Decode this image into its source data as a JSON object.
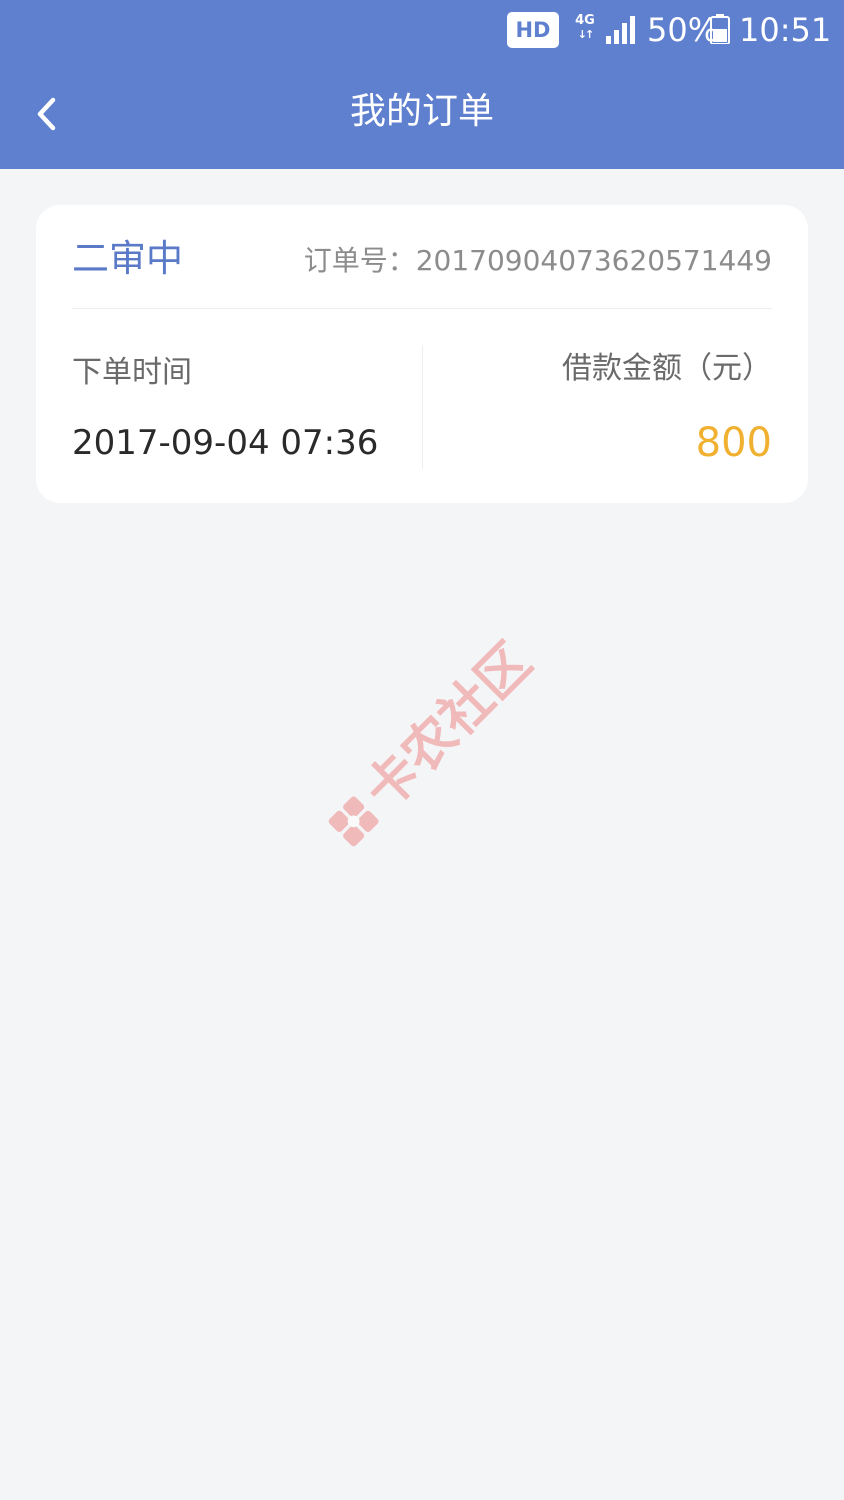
{
  "status_bar": {
    "hd_badge": "HD",
    "network": "4G",
    "battery_percent": "50%",
    "time": "10:51"
  },
  "header": {
    "title": "我的订单",
    "background_color": "#5f7fcf"
  },
  "order": {
    "status": "二审中",
    "order_number_label": "订单号：",
    "order_number": "20170904073620571449",
    "time_label": "下单时间",
    "time_value": "2017-09-04 07:36",
    "amount_label": "借款金额（元）",
    "amount_value": "800",
    "status_color": "#5a7ac7",
    "amount_color": "#f0b030"
  },
  "watermark": {
    "text": "卡农社区",
    "color": "#f08a8a"
  }
}
